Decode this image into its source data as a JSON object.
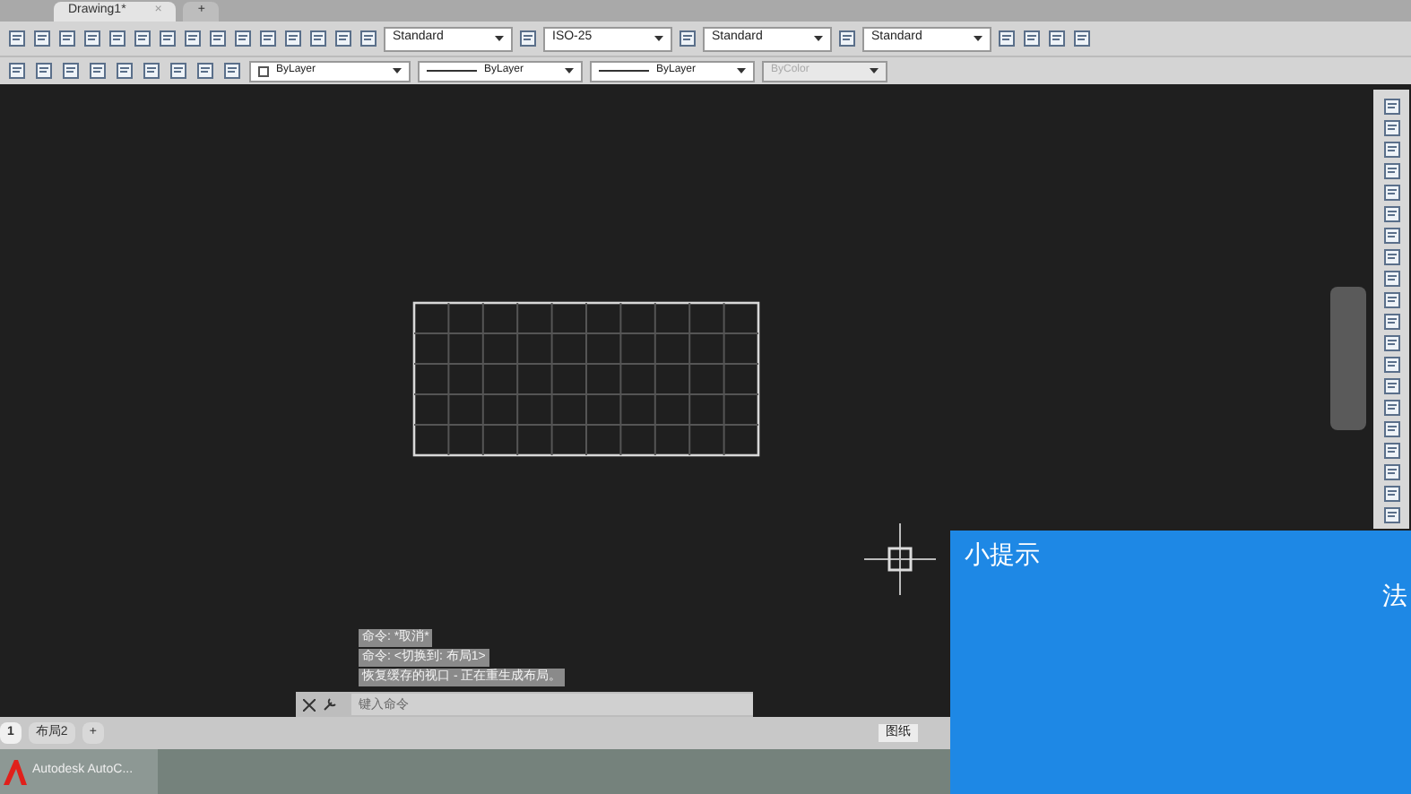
{
  "document_tabs": [
    {
      "label": "Drawing1*",
      "selected": true,
      "close": "×"
    },
    {
      "label": "+",
      "selected": false
    }
  ],
  "toolbar_dropdowns": [
    {
      "value": "Standard",
      "disabled": false
    },
    {
      "value": "ISO-25",
      "disabled": false
    },
    {
      "value": "Standard",
      "disabled": false
    },
    {
      "value": "Standard",
      "disabled": false
    }
  ],
  "property_dropdowns": [
    {
      "value": "ByLayer",
      "kind": "color",
      "disabled": false
    },
    {
      "value": "ByLayer",
      "kind": "line",
      "disabled": false
    },
    {
      "value": "ByLayer",
      "kind": "line",
      "disabled": false
    },
    {
      "value": "ByColor",
      "kind": "plain",
      "disabled": true
    }
  ],
  "command_history": [
    "命令: *取消*",
    "命令:    <切换到: 布局1>",
    "恢复缓存的视口 - 正在重生成布局。"
  ],
  "command_line": {
    "placeholder": "键入命令"
  },
  "layout_tabs": [
    {
      "label": "1",
      "selected": true
    },
    {
      "label": "布局2",
      "selected": false
    },
    {
      "label": "+",
      "selected": false
    }
  ],
  "status_bar": {
    "paper_label": "图纸"
  },
  "taskbar": {
    "app": "Autodesk AutoC..."
  },
  "tip_panel": {
    "title": "小提示",
    "visible_text": "法"
  }
}
